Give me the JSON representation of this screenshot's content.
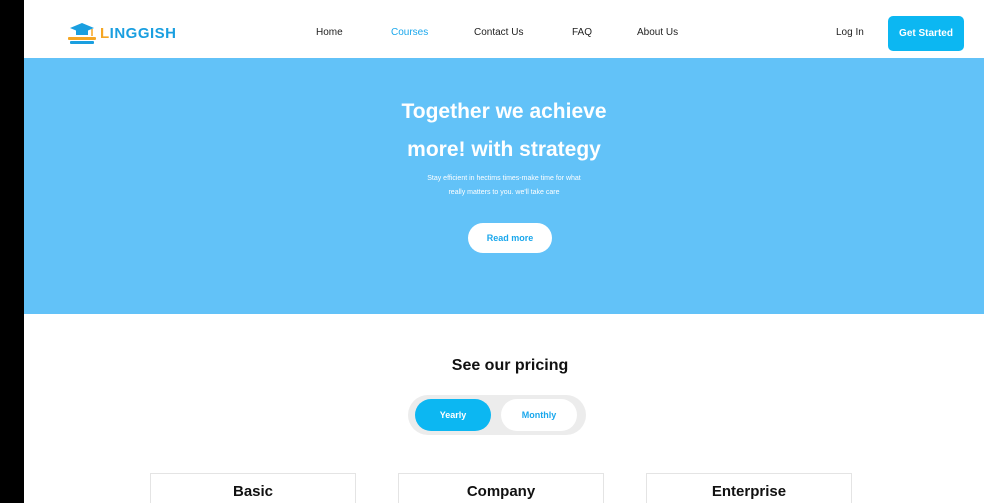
{
  "header": {
    "logo_text_first": "L",
    "logo_text_rest": "INGGISH",
    "nav": [
      {
        "label": "Home",
        "active": false
      },
      {
        "label": "Courses",
        "active": true
      },
      {
        "label": "Contact Us",
        "active": false
      },
      {
        "label": "FAQ",
        "active": false
      },
      {
        "label": "About Us",
        "active": false
      }
    ],
    "login_label": "Log In",
    "cta_label": "Get Started"
  },
  "hero": {
    "title_line1": "Together we achieve",
    "title_line2": "more! with strategy",
    "subtitle_line1": "Stay efficient in hectims times-make time for what",
    "subtitle_line2": "really matters to you. we'll take care",
    "button_label": "Read more"
  },
  "pricing": {
    "title": "See our pricing",
    "toggle": {
      "yearly": "Yearly",
      "monthly": "Monthly",
      "selected": "Yearly"
    },
    "plans": [
      {
        "name": "Basic"
      },
      {
        "name": "Company"
      },
      {
        "name": "Enterprise"
      }
    ]
  },
  "colors": {
    "accent": "#0cb7f2",
    "hero_bg": "#62c2f8",
    "logo_orange": "#f5a623",
    "logo_blue": "#1a9fe0"
  }
}
